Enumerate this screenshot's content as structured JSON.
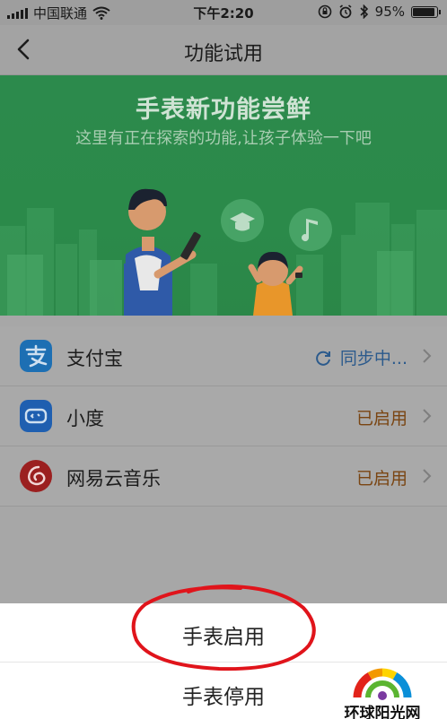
{
  "status_bar": {
    "carrier": "中国联通",
    "time": "下午2:20",
    "battery_text": "95%"
  },
  "nav": {
    "title": "功能试用"
  },
  "banner": {
    "headline": "手表新功能尝鲜",
    "subline": "这里有正在探索的功能,让孩子体验一下吧"
  },
  "apps": [
    {
      "name": "支付宝",
      "status": "同步中...",
      "icon": "alipay-icon",
      "color": "#1d6fb3"
    },
    {
      "name": "小度",
      "status": "已启用",
      "icon": "xiaodu-icon",
      "color": "#1f5fb0"
    },
    {
      "name": "网易云音乐",
      "status": "已启用",
      "icon": "netease-music-icon",
      "color": "#9b1f1f"
    }
  ],
  "sheet": {
    "enable_label": "手表启用",
    "disable_label": "手表停用"
  },
  "watermark": {
    "text": "环球阳光网"
  },
  "colors": {
    "banner_green": "#2c8a4c",
    "status_enabled": "#7a4512",
    "status_sync": "#2b5a8c",
    "annotation_red": "#e0141b"
  }
}
